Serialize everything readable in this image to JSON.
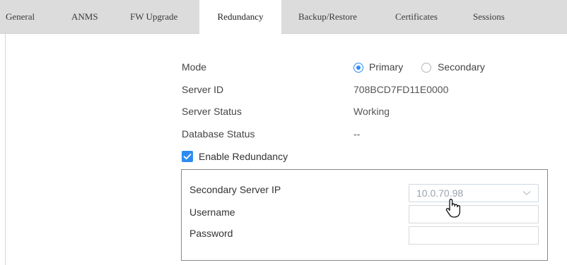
{
  "tabs": [
    {
      "label": "General",
      "active": false
    },
    {
      "label": "ANMS",
      "active": false
    },
    {
      "label": "FW Upgrade",
      "active": false
    },
    {
      "label": "Redundancy",
      "active": true
    },
    {
      "label": "Backup/Restore",
      "active": false
    },
    {
      "label": "Certificates",
      "active": false
    },
    {
      "label": "Sessions",
      "active": false
    }
  ],
  "form": {
    "mode_label": "Mode",
    "mode_options": [
      "Primary",
      "Secondary"
    ],
    "mode_selected": "Primary",
    "server_id_label": "Server ID",
    "server_id_value": "708BCD7FD11E0000",
    "server_status_label": "Server Status",
    "server_status_value": "Working",
    "database_status_label": "Database Status",
    "database_status_value": "--",
    "enable_redundancy_label": "Enable Redundancy",
    "enable_redundancy_checked": true
  },
  "redundancy_panel": {
    "secondary_ip_label": "Secondary Server IP",
    "secondary_ip_value": "10.0.70.98",
    "username_label": "Username",
    "username_value": "",
    "password_label": "Password",
    "password_value": ""
  },
  "colors": {
    "accent": "#2d8cf0",
    "tabbar_bg": "#dcdcdc"
  },
  "icons": {
    "cursor": "hand-pointer-icon",
    "dropdown": "chevron-down-icon",
    "checkbox": "check-icon"
  }
}
